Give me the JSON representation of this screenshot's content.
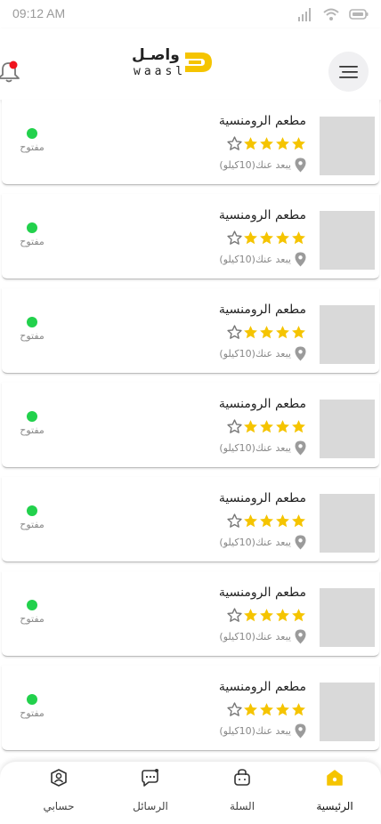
{
  "status_bar": {
    "time": "09:12 AM"
  },
  "app": {
    "logo_ar": "واصـل",
    "logo_en": "waasl",
    "accent": "#F5C400"
  },
  "header": {
    "notification_dot_color": "#F0141E"
  },
  "restaurants": [
    {
      "name": "مطعم الرومنسية",
      "rating": 4,
      "max_rating": 5,
      "distance": "يبعد عنك(10كيلو)",
      "status": "مفتوح",
      "status_color": "#22D14C"
    },
    {
      "name": "مطعم الرومنسية",
      "rating": 4,
      "max_rating": 5,
      "distance": "يبعد عنك(10كيلو)",
      "status": "مفتوح",
      "status_color": "#22D14C"
    },
    {
      "name": "مطعم الرومنسية",
      "rating": 4,
      "max_rating": 5,
      "distance": "يبعد عنك(10كيلو)",
      "status": "مفتوح",
      "status_color": "#22D14C"
    },
    {
      "name": "مطعم الرومنسية",
      "rating": 4,
      "max_rating": 5,
      "distance": "يبعد عنك(10كيلو)",
      "status": "مفتوح",
      "status_color": "#22D14C"
    },
    {
      "name": "مطعم الرومنسية",
      "rating": 4,
      "max_rating": 5,
      "distance": "يبعد عنك(10كيلو)",
      "status": "مفتوح",
      "status_color": "#22D14C"
    },
    {
      "name": "مطعم الرومنسية",
      "rating": 4,
      "max_rating": 5,
      "distance": "يبعد عنك(10كيلو)",
      "status": "مفتوح",
      "status_color": "#22D14C"
    },
    {
      "name": "مطعم الرومنسية",
      "rating": 4,
      "max_rating": 5,
      "distance": "يبعد عنك(10كيلو)",
      "status": "مفتوح",
      "status_color": "#22D14C"
    }
  ],
  "bottom_nav": [
    {
      "label": "الرئيسية",
      "icon": "home-icon",
      "active": true
    },
    {
      "label": "السلة",
      "icon": "basket-icon",
      "active": false
    },
    {
      "label": "الرسائل",
      "icon": "messages-icon",
      "active": false
    },
    {
      "label": "حسابي",
      "icon": "account-icon",
      "active": false
    }
  ]
}
